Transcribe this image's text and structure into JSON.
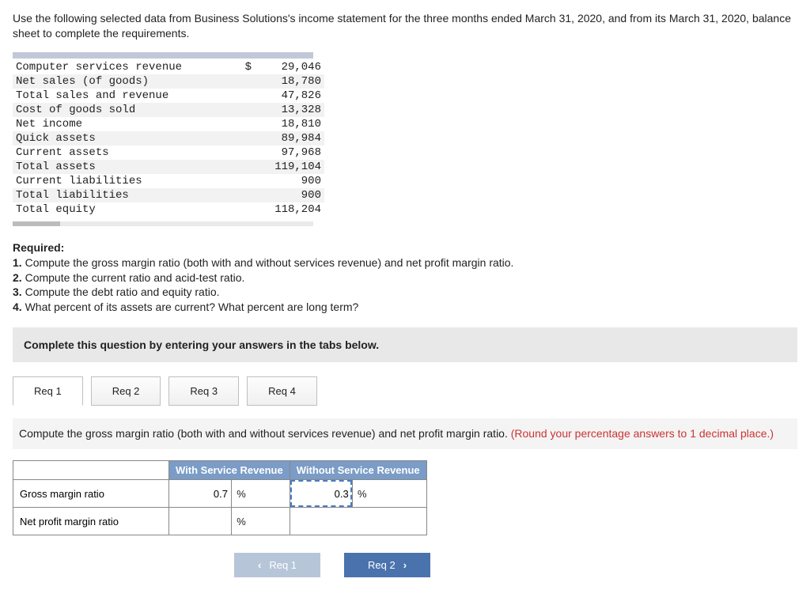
{
  "intro": "Use the following selected data from Business Solutions's income statement for the three months ended March 31, 2020, and from its March 31, 2020, balance sheet to complete the requirements.",
  "financials": [
    {
      "label": "Computer services revenue",
      "sym": "$",
      "value": "29,046",
      "alt": false
    },
    {
      "label": "Net sales (of goods)",
      "sym": "",
      "value": "18,780",
      "alt": true
    },
    {
      "label": "Total sales and revenue",
      "sym": "",
      "value": "47,826",
      "alt": false
    },
    {
      "label": "Cost of goods sold",
      "sym": "",
      "value": "13,328",
      "alt": true
    },
    {
      "label": "Net income",
      "sym": "",
      "value": "18,810",
      "alt": false
    },
    {
      "label": "Quick assets",
      "sym": "",
      "value": "89,984",
      "alt": true
    },
    {
      "label": "Current assets",
      "sym": "",
      "value": "97,968",
      "alt": false
    },
    {
      "label": "Total assets",
      "sym": "",
      "value": "119,104",
      "alt": true
    },
    {
      "label": "Current liabilities",
      "sym": "",
      "value": "900",
      "alt": false
    },
    {
      "label": "Total liabilities",
      "sym": "",
      "value": "900",
      "alt": true
    },
    {
      "label": "Total equity",
      "sym": "",
      "value": "118,204",
      "alt": false
    }
  ],
  "required": {
    "heading": "Required:",
    "items": [
      "1. Compute the gross margin ratio (both with and without services revenue) and net profit margin ratio.",
      "2. Compute the current ratio and acid-test ratio.",
      "3. Compute the debt ratio and equity ratio.",
      "4. What percent of its assets are current? What percent are long term?"
    ]
  },
  "instruction_bar": "Complete this question by entering your answers in the tabs below.",
  "tabs": [
    "Req 1",
    "Req 2",
    "Req 3",
    "Req 4"
  ],
  "active_tab": 0,
  "tab_instruction": {
    "main": "Compute the gross margin ratio (both with and without services revenue) and net profit margin ratio. ",
    "highlight": "(Round your percentage answers to 1 decimal place.)"
  },
  "answer_table": {
    "headers": [
      "With Service Revenue",
      "Without Service Revenue"
    ],
    "rows": [
      {
        "label": "Gross margin ratio",
        "with": "0.7",
        "without": "0.3"
      },
      {
        "label": "Net profit margin ratio",
        "with": "",
        "without": ""
      }
    ],
    "unit": "%"
  },
  "nav": {
    "prev": "Req 1",
    "next": "Req 2"
  }
}
